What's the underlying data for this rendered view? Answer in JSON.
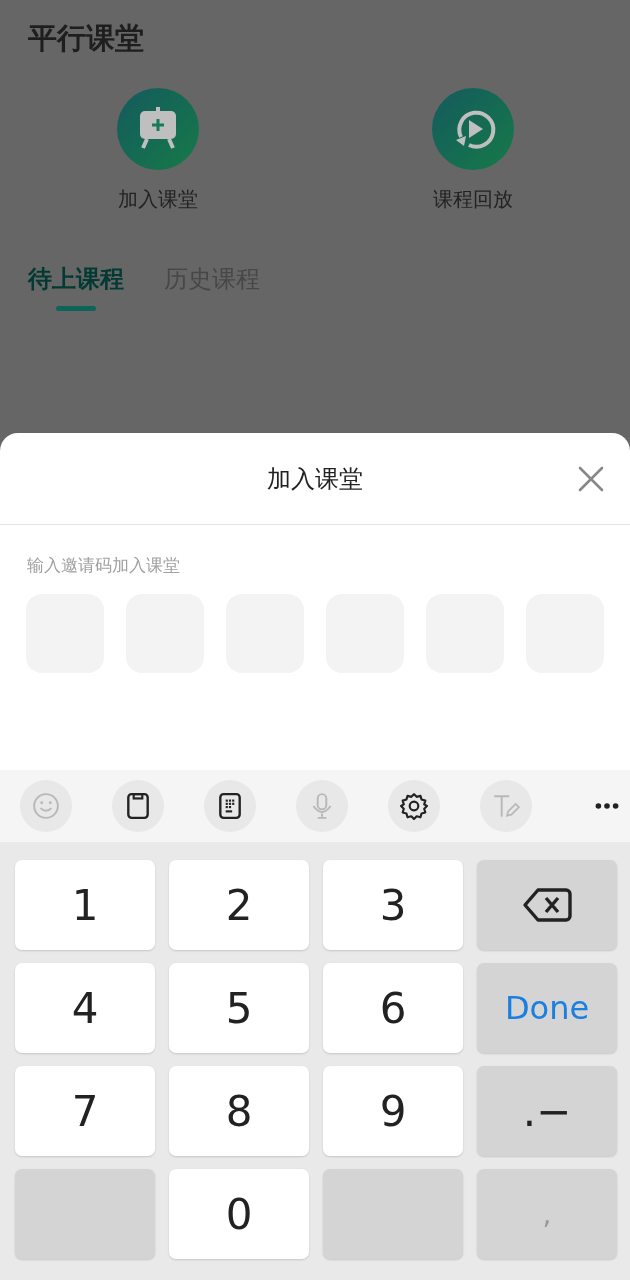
{
  "page": {
    "title": "平行课堂",
    "actions": [
      {
        "kind": "join",
        "label": "加入课堂"
      },
      {
        "kind": "replay",
        "label": "课程回放"
      }
    ],
    "tabs": [
      {
        "label": "待上课程",
        "selected": true
      },
      {
        "label": "历史课程",
        "selected": false
      }
    ]
  },
  "sheet": {
    "title": "加入课堂",
    "hint": "输入邀请码加入课堂",
    "code_boxes": [
      {
        "filled": false
      },
      {
        "filled": false
      },
      {
        "filled": false
      },
      {
        "filled": false
      },
      {
        "filled": false
      },
      {
        "filled": false
      }
    ]
  },
  "keyboard": {
    "toolbar": [
      {
        "kind": "emoji",
        "disabled": true
      },
      {
        "kind": "clipboard",
        "disabled": false
      },
      {
        "kind": "keypad",
        "disabled": false
      },
      {
        "kind": "mic",
        "disabled": true
      },
      {
        "kind": "settings",
        "disabled": false
      },
      {
        "kind": "handwriting",
        "disabled": true
      },
      {
        "kind": "more",
        "disabled": false
      }
    ],
    "keys": [
      {
        "kind": "digit",
        "label": "1"
      },
      {
        "kind": "digit",
        "label": "2"
      },
      {
        "kind": "digit",
        "label": "3"
      },
      {
        "kind": "backspace"
      },
      {
        "kind": "digit",
        "label": "4"
      },
      {
        "kind": "digit",
        "label": "5"
      },
      {
        "kind": "digit",
        "label": "6"
      },
      {
        "kind": "done",
        "label": "Done"
      },
      {
        "kind": "digit",
        "label": "7"
      },
      {
        "kind": "digit",
        "label": "8"
      },
      {
        "kind": "digit",
        "label": "9"
      },
      {
        "kind": "symbol",
        "label": ".−"
      },
      {
        "kind": "blank"
      },
      {
        "kind": "digit",
        "label": "0"
      },
      {
        "kind": "blank"
      },
      {
        "kind": "faint",
        "label": ","
      }
    ]
  }
}
